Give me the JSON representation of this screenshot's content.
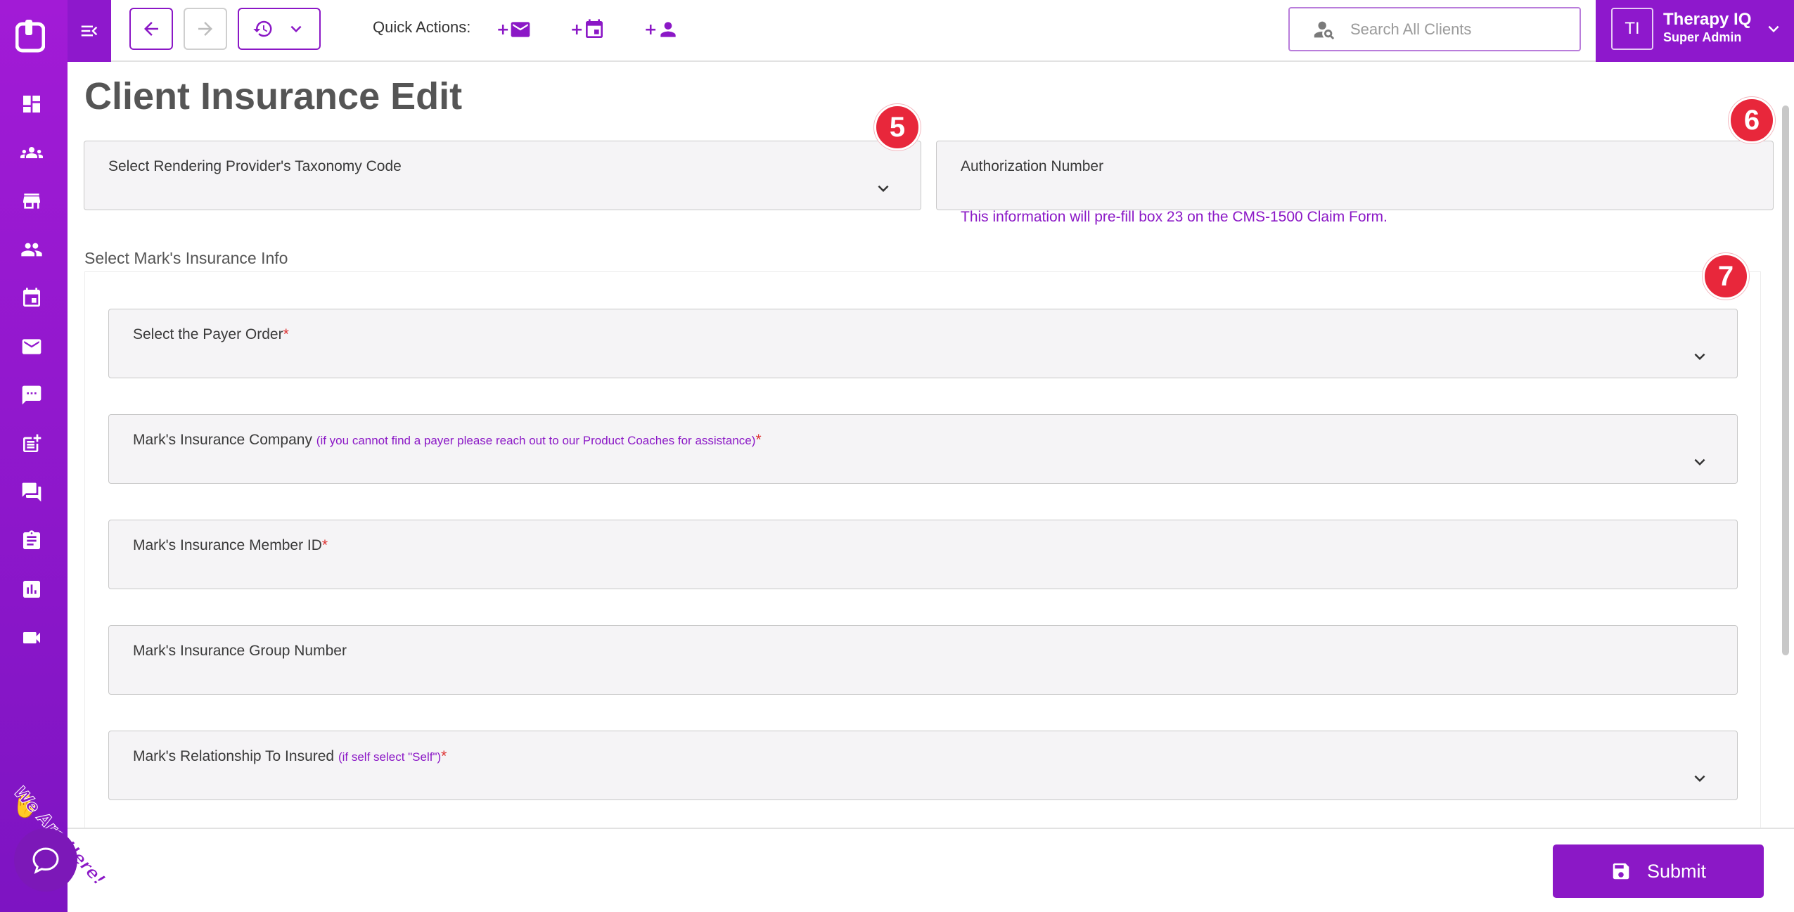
{
  "app": {
    "title": "Therapy IQ"
  },
  "topbar": {
    "quick_actions_label": "Quick Actions:",
    "quick_actions": [
      {
        "prefix": "+",
        "icon": "mail-icon"
      },
      {
        "prefix": "+",
        "icon": "calendar-icon"
      },
      {
        "prefix": "+",
        "icon": "person-icon"
      }
    ],
    "search_placeholder": "Search All Clients",
    "user": {
      "initials": "TI",
      "name": "Therapy IQ",
      "role": "Super Admin"
    }
  },
  "sidebar": {
    "items": [
      {
        "icon": "dashboard-icon"
      },
      {
        "icon": "groups-icon"
      },
      {
        "icon": "store-icon"
      },
      {
        "icon": "people-icon"
      },
      {
        "icon": "calendar-icon"
      },
      {
        "icon": "mail-icon"
      },
      {
        "icon": "chat-icon"
      },
      {
        "icon": "note-add-icon"
      },
      {
        "icon": "forum-icon"
      },
      {
        "icon": "assignment-icon"
      },
      {
        "icon": "chart-icon"
      },
      {
        "icon": "video-icon"
      }
    ]
  },
  "page": {
    "title": "Client Insurance Edit",
    "taxonomy_label": "Select Rendering Provider's Taxonomy Code",
    "authorization_label": "Authorization Number",
    "authorization_helper": "This information will pre-fill box 23 on the CMS-1500 Claim Form.",
    "section_label": "Select Mark's Insurance Info",
    "fields": {
      "payer_order": {
        "label": "Select the Payer Order",
        "required": "*"
      },
      "insurance_company": {
        "label": "Mark's Insurance Company",
        "hint": "(if you cannot find a payer please reach out to our Product Coaches for assistance)",
        "required": "*"
      },
      "member_id": {
        "label": "Mark's Insurance Member ID",
        "required": "*"
      },
      "group_number": {
        "label": "Mark's Insurance Group Number"
      },
      "relationship": {
        "label": "Mark's Relationship To Insured",
        "hint": "(if self select \"Self\")",
        "required": "*"
      }
    },
    "steps": [
      "5",
      "6",
      "7"
    ]
  },
  "footer": {
    "submit_label": "Submit"
  },
  "chat_widget": {
    "tag": "We Are Here!"
  },
  "colors": {
    "brand": "#8b18c6",
    "step_badge": "#e8273b"
  }
}
